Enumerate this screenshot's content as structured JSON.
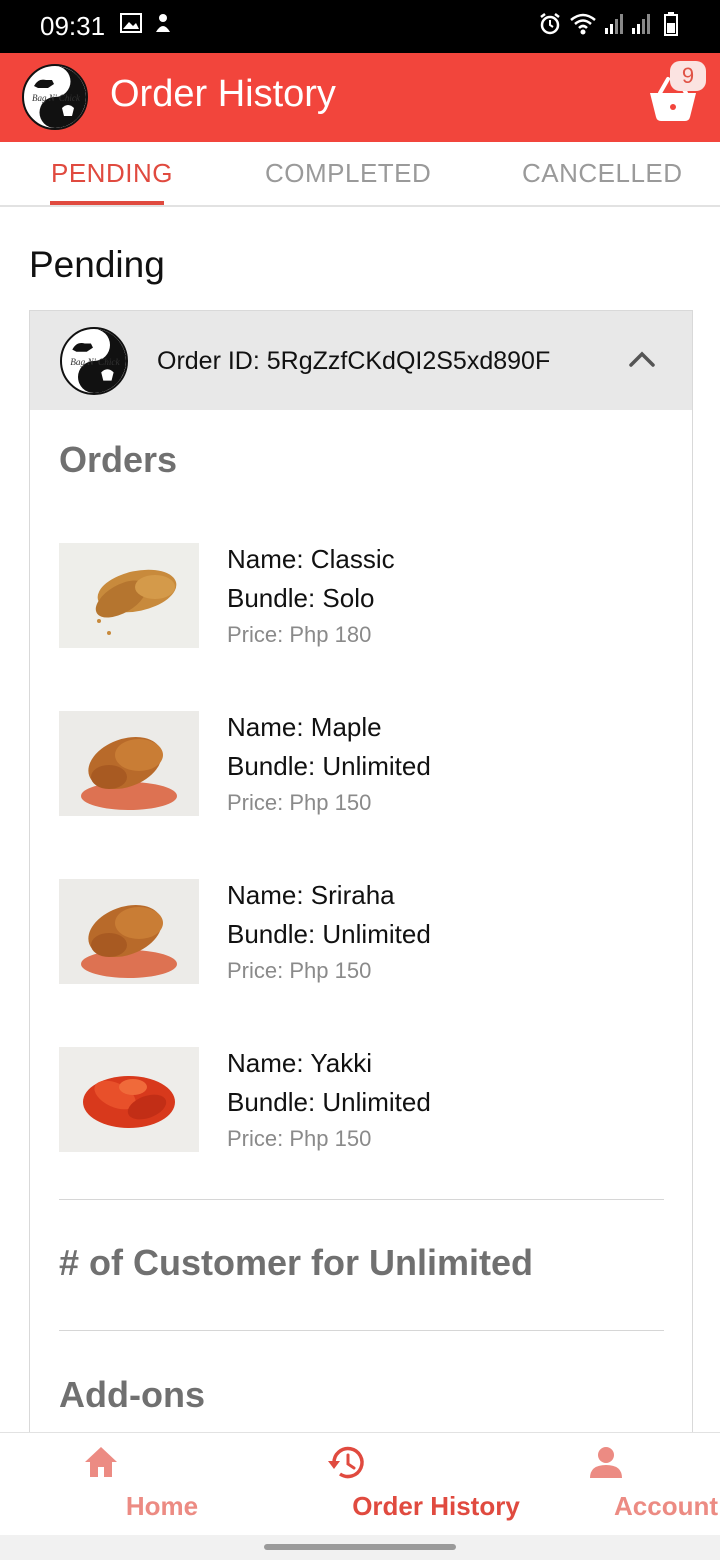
{
  "status_bar": {
    "time": "09:31",
    "icons": [
      "image-icon",
      "notification-icon",
      "alarm-icon",
      "wifi-icon",
      "signal-icon",
      "signal-icon",
      "battery-icon"
    ]
  },
  "app_bar": {
    "title": "Order History",
    "cart_count": "9",
    "logo_text": "Bag N' Chick",
    "color": "#f2453c"
  },
  "tabs": [
    {
      "label": "PENDING",
      "active": true
    },
    {
      "label": "COMPLETED",
      "active": false
    },
    {
      "label": "CANCELLED",
      "active": false
    }
  ],
  "section": {
    "title": "Pending"
  },
  "order": {
    "id_label": "Order ID: 5RgZzfCKdQI2S5xd890F",
    "orders_title": "Orders",
    "items": [
      {
        "name": "Name: Classic",
        "bundle": "Bundle: Solo",
        "price": "Price: Php 180"
      },
      {
        "name": "Name: Maple",
        "bundle": "Bundle: Unlimited",
        "price": "Price: Php 150"
      },
      {
        "name": "Name: Sriraha",
        "bundle": "Bundle: Unlimited",
        "price": "Price: Php 150"
      },
      {
        "name": "Name: Yakki",
        "bundle": "Bundle: Unlimited",
        "price": "Price: Php 150"
      }
    ],
    "customers_title": "# of Customer for Unlimited",
    "addons_title": "Add-ons"
  },
  "bottom_nav": [
    {
      "label": "Home",
      "icon": "home-icon",
      "active": false
    },
    {
      "label": "Order History",
      "icon": "history-icon",
      "active": true
    },
    {
      "label": "Account",
      "icon": "account-icon",
      "active": false
    }
  ],
  "colors": {
    "accent": "#e04a3f",
    "inactive_nav": "#ec8b83"
  }
}
